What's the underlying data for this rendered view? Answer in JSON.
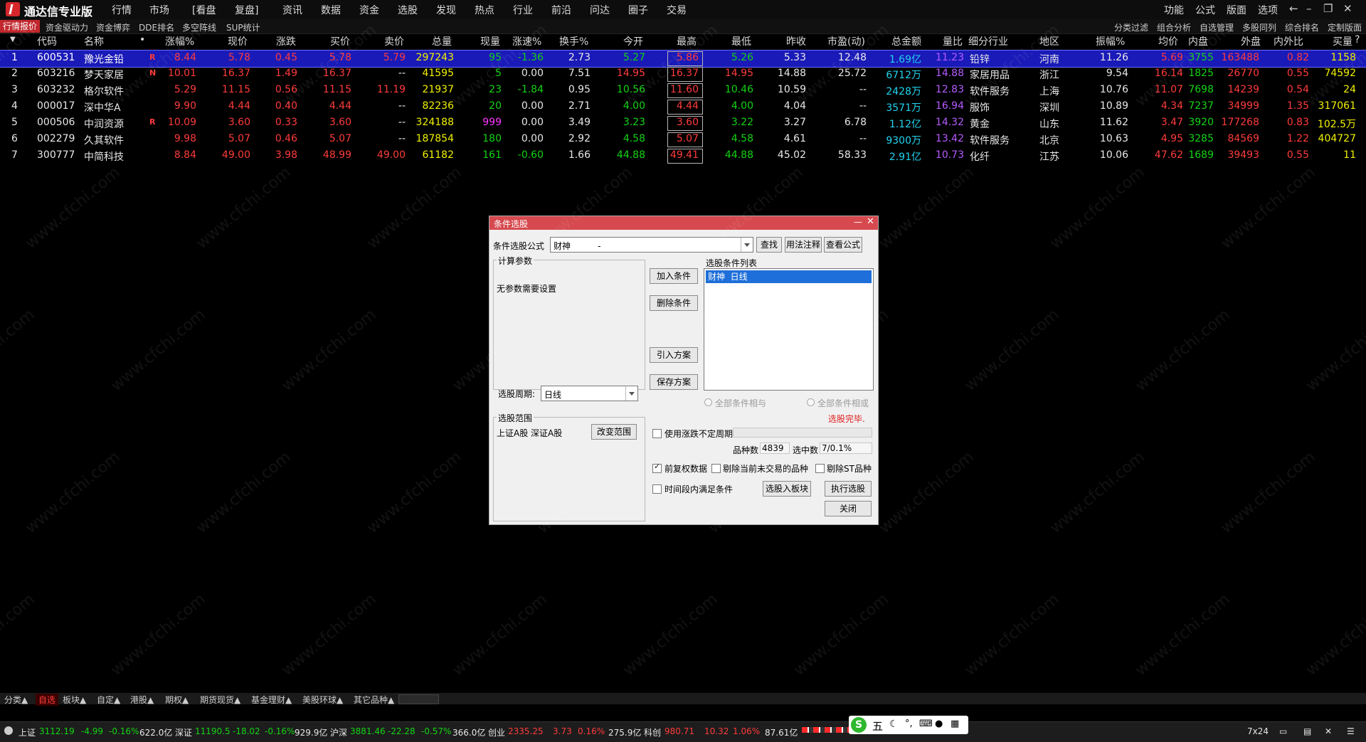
{
  "app": {
    "title": "通达信专业版",
    "menu": [
      "行情",
      "市场",
      "[看盘",
      "复盘]",
      "资讯",
      "数据",
      "资金",
      "选股",
      "发现",
      "热点",
      "行业",
      "前沿",
      "问达",
      "圈子",
      "交易"
    ],
    "right_menu": [
      "功能",
      "公式",
      "版面",
      "选项"
    ]
  },
  "tabs": {
    "active": "行情报价",
    "left": [
      "资金驱动力",
      "资金博弈",
      "DDE排名",
      "多空阵线",
      "SUP统计"
    ],
    "right": [
      "分类过滤",
      "组合分析",
      "自选管理",
      "多股同列",
      "综合排名",
      "定制版面"
    ]
  },
  "table": {
    "headers": [
      "代码",
      "名称",
      "•",
      "涨幅%",
      "现价",
      "涨跌",
      "买价",
      "卖价",
      "总量",
      "现量",
      "涨速%",
      "换手%",
      "今开",
      "最高",
      "最低",
      "昨收",
      "市盈(动)",
      "总金额",
      "量比",
      "细分行业",
      "地区",
      "振幅%",
      "均价",
      "内盘",
      "外盘",
      "内外比",
      "买量"
    ],
    "rows": [
      {
        "idx": "1",
        "code": "600531",
        "name": "豫光金铅",
        "flag": "R",
        "chg_pct": "8.44",
        "price": "5.78",
        "chg": "0.45",
        "bid": "5.78",
        "ask": "5.79",
        "vol": "297243",
        "cur_vol": "95",
        "speed": "-1.36",
        "turnover": "2.73",
        "open": "5.27",
        "high": "5.86",
        "low": "5.26",
        "prev": "5.33",
        "pe": "12.48",
        "amount": "1.69亿",
        "vol_ratio": "11.23",
        "industry": "铅锌",
        "region": "河南",
        "amp": "11.26",
        "avg": "5.69",
        "inner": "3755",
        "outer": "163488",
        "io_ratio": "0.82",
        "bid_vol": "1158"
      },
      {
        "idx": "2",
        "code": "603216",
        "name": "梦天家居",
        "flag": "N",
        "chg_pct": "10.01",
        "price": "16.37",
        "chg": "1.49",
        "bid": "16.37",
        "ask": "--",
        "vol": "41595",
        "cur_vol": "5",
        "speed": "0.00",
        "turnover": "7.51",
        "open": "14.95",
        "high": "16.37",
        "low": "14.95",
        "prev": "14.88",
        "pe": "25.72",
        "amount": "6712万",
        "vol_ratio": "14.88",
        "industry": "家居用品",
        "region": "浙江",
        "amp": "9.54",
        "avg": "16.14",
        "inner": "1825",
        "outer": "26770",
        "io_ratio": "0.55",
        "bid_vol": "74592"
      },
      {
        "idx": "3",
        "code": "603232",
        "name": "格尔软件",
        "flag": "",
        "chg_pct": "5.29",
        "price": "11.15",
        "chg": "0.56",
        "bid": "11.15",
        "ask": "11.19",
        "vol": "21937",
        "cur_vol": "23",
        "speed": "-1.84",
        "turnover": "0.95",
        "open": "10.56",
        "high": "11.60",
        "low": "10.46",
        "prev": "10.59",
        "pe": "--",
        "amount": "2428万",
        "vol_ratio": "12.83",
        "industry": "软件服务",
        "region": "上海",
        "amp": "10.76",
        "avg": "11.07",
        "inner": "7698",
        "outer": "14239",
        "io_ratio": "0.54",
        "bid_vol": "24"
      },
      {
        "idx": "4",
        "code": "000017",
        "name": "深中华A",
        "flag": "",
        "chg_pct": "9.90",
        "price": "4.44",
        "chg": "0.40",
        "bid": "4.44",
        "ask": "--",
        "vol": "82236",
        "cur_vol": "20",
        "speed": "0.00",
        "turnover": "2.71",
        "open": "4.00",
        "high": "4.44",
        "low": "4.00",
        "prev": "4.04",
        "pe": "--",
        "amount": "3571万",
        "vol_ratio": "16.94",
        "industry": "服饰",
        "region": "深圳",
        "amp": "10.89",
        "avg": "4.34",
        "inner": "7237",
        "outer": "34999",
        "io_ratio": "1.35",
        "bid_vol": "317061"
      },
      {
        "idx": "5",
        "code": "000506",
        "name": "中润资源",
        "flag": "R",
        "chg_pct": "10.09",
        "price": "3.60",
        "chg": "0.33",
        "bid": "3.60",
        "ask": "--",
        "vol": "324188",
        "cur_vol": "999",
        "speed": "0.00",
        "turnover": "3.49",
        "open": "3.23",
        "high": "3.60",
        "low": "3.22",
        "prev": "3.27",
        "pe": "6.78",
        "amount": "1.12亿",
        "vol_ratio": "14.32",
        "industry": "黄金",
        "region": "山东",
        "amp": "11.62",
        "avg": "3.47",
        "inner": "3920",
        "outer": "177268",
        "io_ratio": "0.83",
        "bid_vol": "102.5万"
      },
      {
        "idx": "6",
        "code": "002279",
        "name": "久其软件",
        "flag": "",
        "chg_pct": "9.98",
        "price": "5.07",
        "chg": "0.46",
        "bid": "5.07",
        "ask": "--",
        "vol": "187854",
        "cur_vol": "180",
        "speed": "0.00",
        "turnover": "2.92",
        "open": "4.58",
        "high": "5.07",
        "low": "4.58",
        "prev": "4.61",
        "pe": "--",
        "amount": "9300万",
        "vol_ratio": "13.42",
        "industry": "软件服务",
        "region": "北京",
        "amp": "10.63",
        "avg": "4.95",
        "inner": "3285",
        "outer": "84569",
        "io_ratio": "1.22",
        "bid_vol": "404727"
      },
      {
        "idx": "7",
        "code": "300777",
        "name": "中简科技",
        "flag": "",
        "chg_pct": "8.84",
        "price": "49.00",
        "chg": "3.98",
        "bid": "48.99",
        "ask": "49.00",
        "vol": "61182",
        "cur_vol": "161",
        "speed": "-0.60",
        "turnover": "1.66",
        "open": "44.88",
        "high": "49.41",
        "low": "44.88",
        "prev": "45.02",
        "pe": "58.33",
        "amount": "2.91亿",
        "vol_ratio": "10.73",
        "industry": "化纤",
        "region": "江苏",
        "amp": "10.06",
        "avg": "47.62",
        "inner": "1689",
        "outer": "39493",
        "io_ratio": "0.55",
        "bid_vol": "11"
      }
    ]
  },
  "bottom_tabs": [
    "分类▲",
    "自选",
    "板块▲",
    "自定▲",
    "港股▲",
    "期权▲",
    "期货现货▲",
    "基金理财▲",
    "美股环球▲",
    "其它品种▲"
  ],
  "status": {
    "sh": {
      "name": "上证",
      "val": "3112.19",
      "chg": "-4.99",
      "pct": "-0.16%",
      "amt": "622.0亿"
    },
    "sz": {
      "name": "深证",
      "val": "11190.5",
      "chg": "-18.02",
      "pct": "-0.16%",
      "amt": "929.9亿"
    },
    "hs": {
      "name": "沪深",
      "val": "3881.46",
      "chg": "-22.28",
      "pct": "-0.57%",
      "amt": "366.0亿"
    },
    "cy": {
      "name": "创业",
      "val": "2335.25",
      "chg": "3.73",
      "pct": "0.16%",
      "amt": "275.9亿"
    },
    "kc": {
      "name": "科创",
      "val": "980.71",
      "chg": "10.32",
      "pct": "1.06%",
      "amt": "87.61亿"
    },
    "ime": "五",
    "right": "7x24"
  },
  "dialog": {
    "title": "条件选股",
    "formula_label": "条件选股公式",
    "formula_value": "财神          -",
    "btn_find": "查找",
    "btn_usage": "用法注释",
    "btn_view": "查看公式",
    "params_group": "计算参数",
    "params_text": "无参数需要设置",
    "period_label": "选股周期:",
    "period_value": "日线",
    "btn_add": "加入条件",
    "btn_delete": "删除条件",
    "btn_import": "引入方案",
    "btn_save": "保存方案",
    "cond_list_label": "选股条件列表",
    "cond_items": [
      "财神  日线"
    ],
    "radio_and": "全部条件相与",
    "radio_or": "全部条件相或",
    "done_text": "选股完毕.",
    "scope_group": "选股范围",
    "scope_text": "上证A股 深证A股",
    "btn_change_scope": "改变范围",
    "chk_period": "使用涨跌不定周期",
    "count_label": "品种数",
    "count_value": "4839",
    "selected_label": "选中数",
    "selected_value": "7/0.1%",
    "chk_adjust": "前复权数据",
    "chk_no_trade": "剔除当前未交易的品种",
    "chk_st": "剔除ST品种",
    "chk_time": "时间段内满足条件",
    "btn_to_block": "选股入板块",
    "btn_execute": "执行选股",
    "btn_close": "关闭",
    "colors": {
      "title_bar": "#d64a4f",
      "selection": "#1e6fd9",
      "done_text": "#e02020"
    }
  },
  "watermark": "www.cfchi.com"
}
